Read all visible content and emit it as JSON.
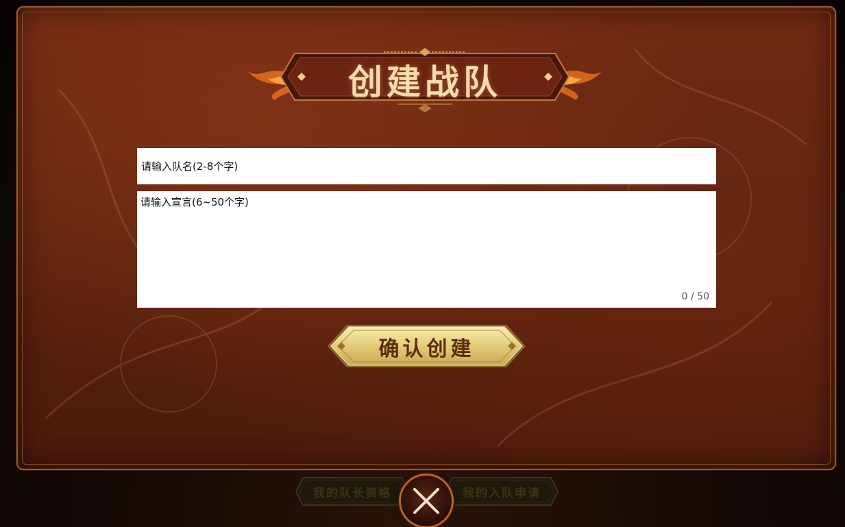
{
  "modal": {
    "title": "创建战队",
    "name_input": {
      "placeholder": "请输入队名(2-8个字)",
      "value": ""
    },
    "motto_input": {
      "placeholder": "请输入宣言(6~50个字)",
      "value": "",
      "counter": "0 / 50"
    },
    "confirm_button": "确认创建"
  },
  "bottom_bar": {
    "tabs": [
      {
        "label": "我的队长资格"
      },
      {
        "label": "我的入队申请"
      }
    ],
    "close_icon": "close-x-icon"
  },
  "colors": {
    "panel_bg": "#5e2310",
    "panel_border": "#9a5a2a",
    "title_text": "#f6dcae",
    "button_gold": "#e9d48a",
    "button_text": "#5a2e0e"
  }
}
